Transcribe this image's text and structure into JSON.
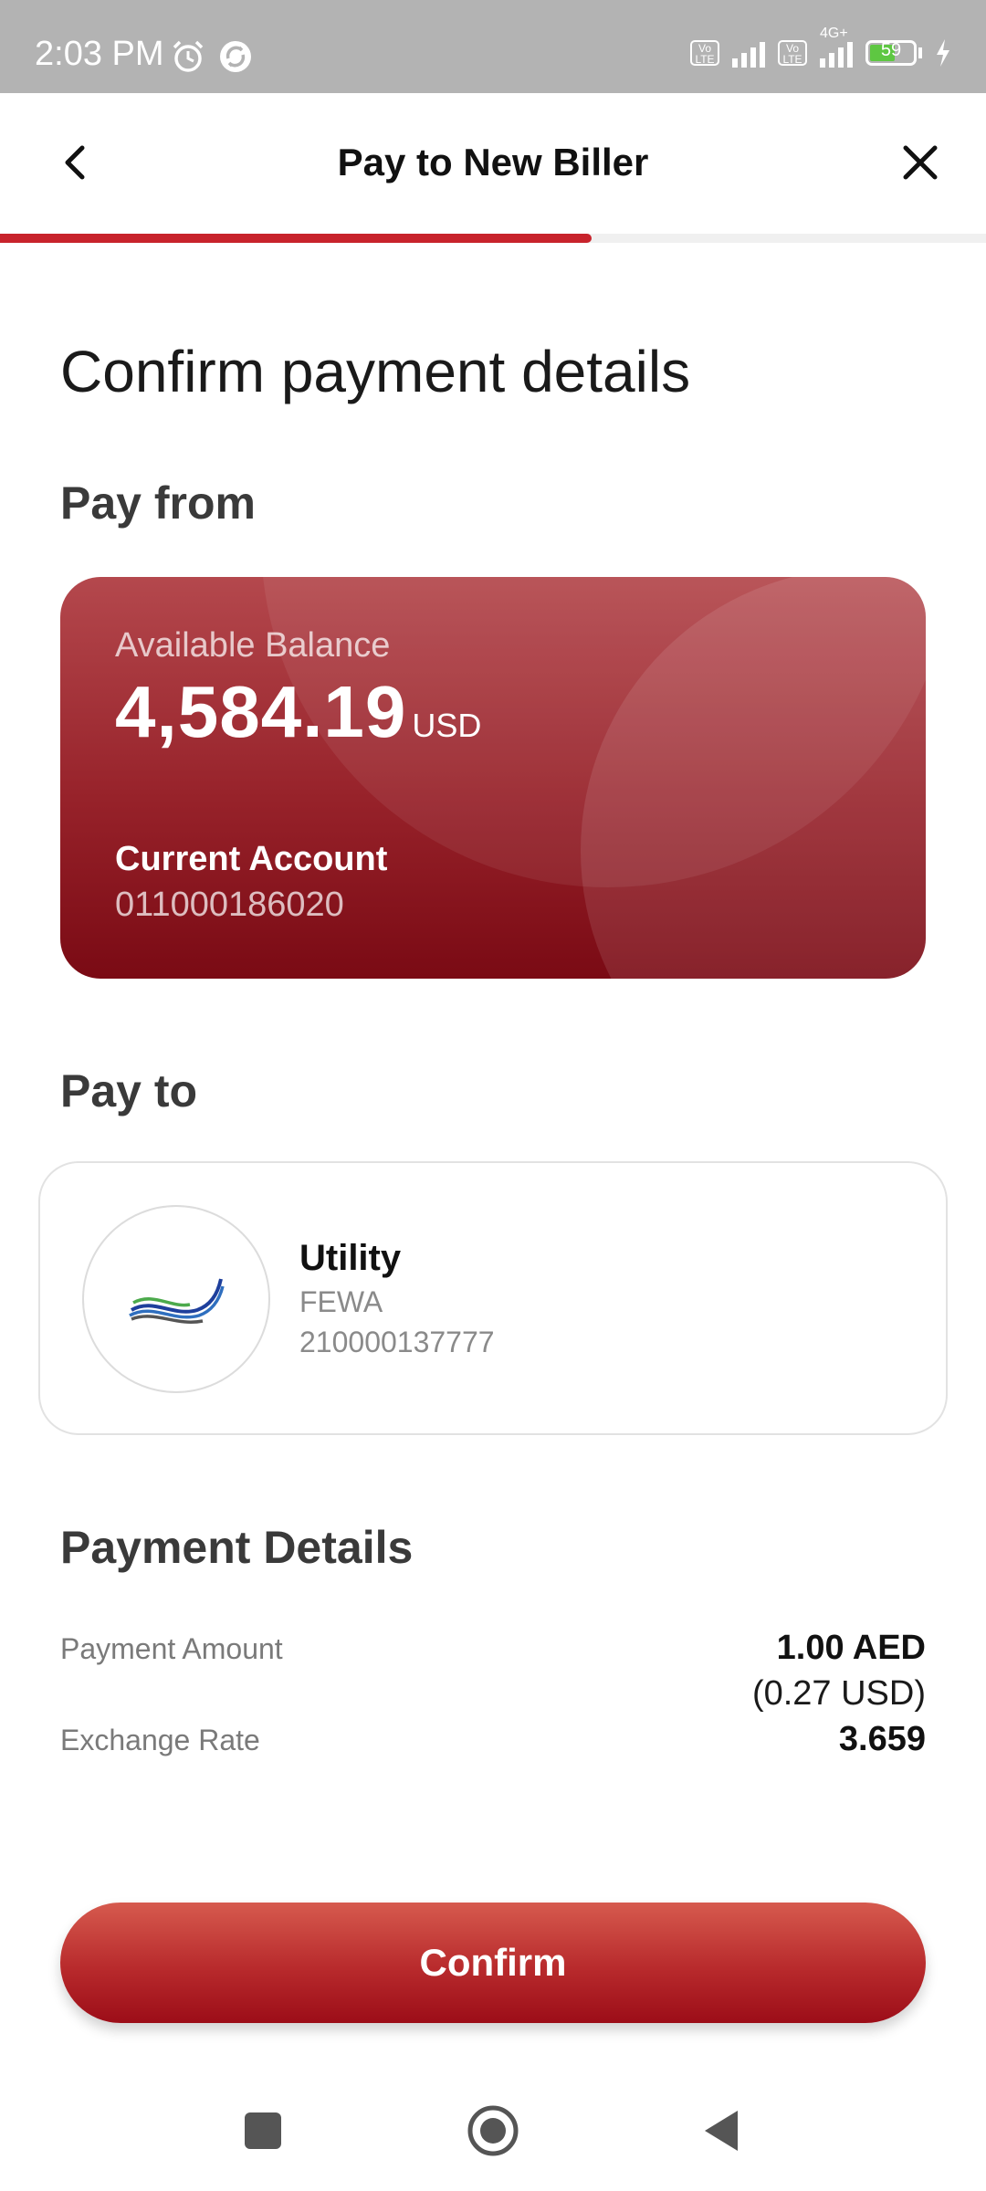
{
  "status_bar": {
    "time": "2:03 PM",
    "battery": "59",
    "network": "4G+",
    "volte_label": "Vo LTE"
  },
  "header": {
    "title": "Pay to New Biller",
    "progress_fraction": 0.6
  },
  "page": {
    "heading": "Confirm payment details"
  },
  "pay_from": {
    "section_title": "Pay from",
    "balance_label": "Available Balance",
    "balance_amount": "4,584.19",
    "balance_currency": "USD",
    "account_type": "Current Account",
    "account_number": "011000186020"
  },
  "pay_to": {
    "section_title": "Pay to",
    "biller_category": "Utility",
    "biller_code": "FEWA",
    "biller_account": "210000137777"
  },
  "payment_details": {
    "section_title": "Payment Details",
    "amount_label": "Payment Amount",
    "amount_value": "1.00 AED",
    "amount_converted": "(0.27 USD)",
    "rate_label": "Exchange Rate",
    "rate_value": "3.659"
  },
  "actions": {
    "confirm_label": "Confirm"
  },
  "colors": {
    "accent": "#c8232c",
    "card_top": "#b4484d",
    "card_bottom": "#7a0a14"
  },
  "icons": {
    "back": "chevron-left-icon",
    "close": "close-icon",
    "biller_logo": "fewa-wave-logo"
  }
}
